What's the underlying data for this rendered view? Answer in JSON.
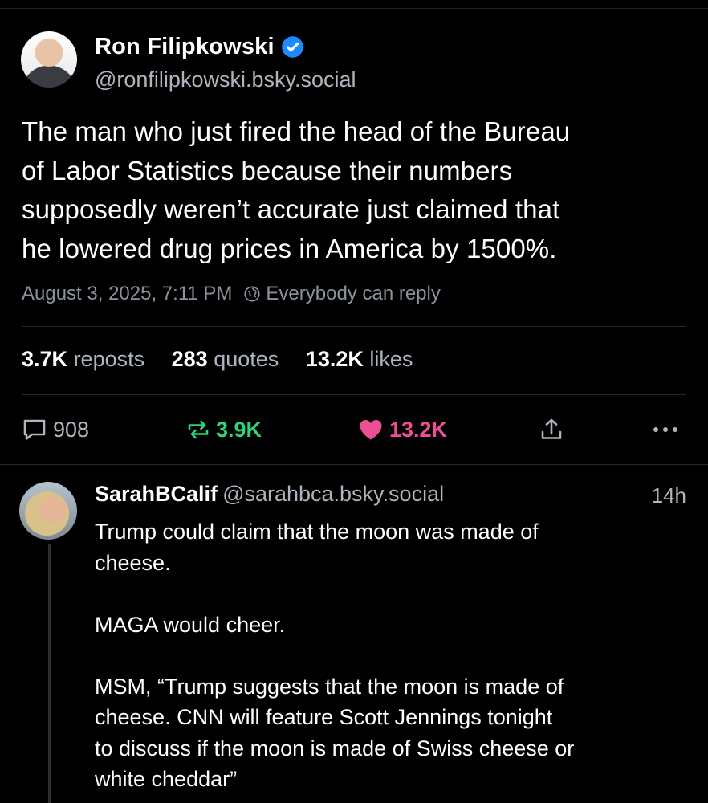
{
  "post": {
    "author_name": "Ron Filipkowski",
    "handle": "@ronfilipkowski.bsky.social",
    "text_lines": [
      "The man who just fired the head of the Bureau",
      "of Labor Statistics because their numbers",
      "supposedly weren’t accurate just claimed that",
      "he lowered drug prices in America by 1500%."
    ],
    "timestamp": "August 3, 2025, 7:11 PM",
    "reply_setting": "Everybody can reply",
    "stats": {
      "reposts_count": "3.7K",
      "reposts_label": "reposts",
      "quotes_count": "283",
      "quotes_label": "quotes",
      "likes_count": "13.2K",
      "likes_label": "likes"
    },
    "actions": {
      "reply_count": "908",
      "repost_count": "3.9K",
      "like_count": "13.2K"
    },
    "icons": [
      "verified-icon",
      "globe-icon",
      "reply-icon",
      "repost-icon",
      "heart-icon",
      "share-icon",
      "more-icon"
    ],
    "colors": {
      "verified": "#1a8cff",
      "repost": "#2fd47a",
      "like": "#ee4e95",
      "background": "#000000"
    }
  },
  "reply": {
    "author_name": "SarahBCalif",
    "handle": "@sarahbca.bsky.social",
    "time": "14h",
    "paragraphs": [
      [
        "Trump could claim that the moon was made of",
        "cheese."
      ],
      [
        "MAGA would cheer."
      ],
      [
        "MSM, “Trump suggests that the moon is made of",
        "cheese. CNN will feature Scott Jennings tonight",
        "to discuss if the moon is made of Swiss cheese or",
        "white cheddar”"
      ]
    ]
  }
}
